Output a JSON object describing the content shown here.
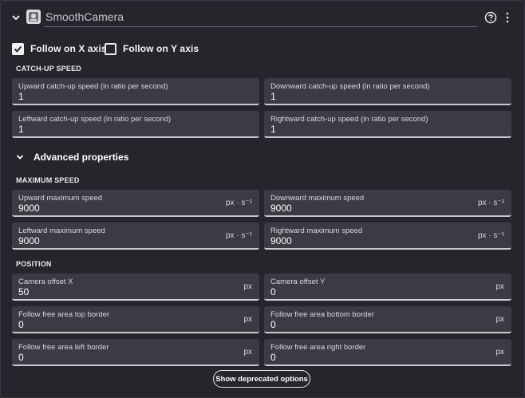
{
  "header": {
    "behavior_name": "SmoothCamera",
    "icons": {
      "collapse": "chevron-down-icon",
      "behavior": "camera-behavior-icon",
      "help": "help-circle-icon",
      "more": "more-vertical-icon"
    }
  },
  "follow": {
    "x": {
      "label": "Follow on X axis",
      "checked": true
    },
    "y": {
      "label": "Follow on Y axis",
      "checked": false
    }
  },
  "sections": {
    "catchup": "CATCH-UP SPEED",
    "advanced": "Advanced properties",
    "max_speed": "MAXIMUM SPEED",
    "position": "POSITION"
  },
  "catchup": {
    "up": {
      "label": "Upward catch-up speed (in ratio per second)",
      "value": "1"
    },
    "down": {
      "label": "Downward catch-up speed (in ratio per second)",
      "value": "1"
    },
    "left": {
      "label": "Leftward catch-up speed (in ratio per second)",
      "value": "1"
    },
    "right": {
      "label": "Rightward catch-up speed (in ratio per second)",
      "value": "1"
    }
  },
  "max_speed": {
    "unit": "px · s⁻¹",
    "up": {
      "label": "Upward maximum speed",
      "value": "9000"
    },
    "down": {
      "label": "Downward maximum speed",
      "value": "9000"
    },
    "left": {
      "label": "Leftward maximum speed",
      "value": "9000"
    },
    "right": {
      "label": "Rightward maximum speed",
      "value": "9000"
    }
  },
  "position": {
    "unit": "px",
    "offset_x": {
      "label": "Camera offset X",
      "value": "50"
    },
    "offset_y": {
      "label": "Camera offset Y",
      "value": "0"
    },
    "top": {
      "label": "Follow free area top border",
      "value": "0"
    },
    "bottom": {
      "label": "Follow free area bottom border",
      "value": "0"
    },
    "left": {
      "label": "Follow free area left border",
      "value": "0"
    },
    "right": {
      "label": "Follow free area right border",
      "value": "0"
    }
  },
  "buttons": {
    "deprecated": "Show deprecated options"
  }
}
